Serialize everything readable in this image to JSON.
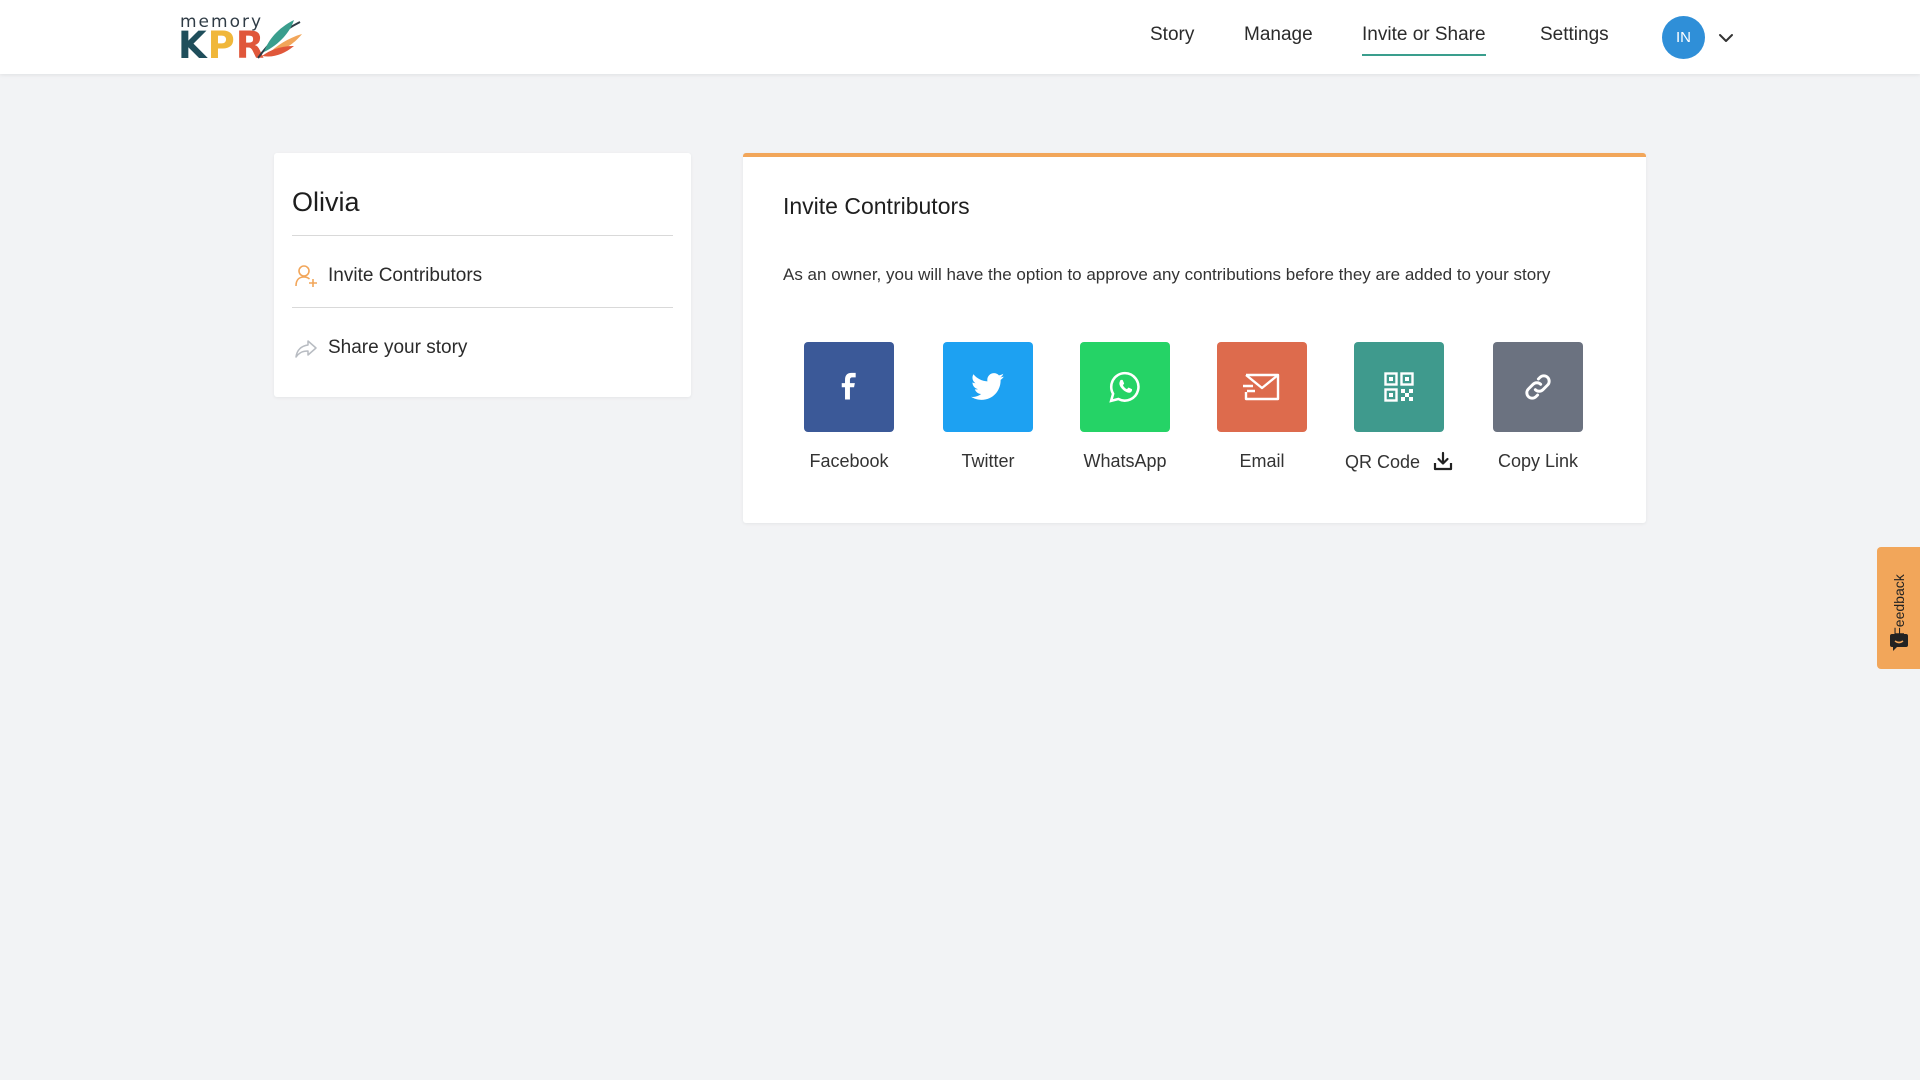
{
  "logo": {
    "small": "memory",
    "k": "K",
    "p": "P",
    "r": "R"
  },
  "nav": {
    "items": [
      {
        "label": "Story"
      },
      {
        "label": "Manage"
      },
      {
        "label": "Invite or Share"
      },
      {
        "label": "Settings"
      }
    ],
    "active": "Invite or Share",
    "avatar_initials": "IN"
  },
  "sidebar": {
    "story_name": "Olivia",
    "items": [
      {
        "label": "Invite Contributors",
        "icon": "add-user-icon"
      },
      {
        "label": "Share your story",
        "icon": "share-arrow-icon"
      }
    ]
  },
  "main": {
    "title": "Invite Contributors",
    "description": "As an owner, you will have the option to approve any contributions before they are added to your story",
    "share_options": [
      {
        "label": "Facebook",
        "icon": "facebook-icon",
        "color": "#3b5998"
      },
      {
        "label": "Twitter",
        "icon": "twitter-icon",
        "color": "#1da1f2"
      },
      {
        "label": "WhatsApp",
        "icon": "whatsapp-icon",
        "color": "#25d366"
      },
      {
        "label": "Email",
        "icon": "email-icon",
        "color": "#dd6b4d"
      },
      {
        "label": "QR Code",
        "icon": "qr-code-icon",
        "color": "#3f9a8d"
      },
      {
        "label": "Copy Link",
        "icon": "link-icon",
        "color": "#6b7280"
      }
    ]
  },
  "feedback": {
    "label": "Feedback",
    "color": "#f2a65a"
  },
  "colors": {
    "accent": "#f2a65a",
    "nav_underline": "#3a9e8d",
    "avatar": "#2f8fd8"
  }
}
